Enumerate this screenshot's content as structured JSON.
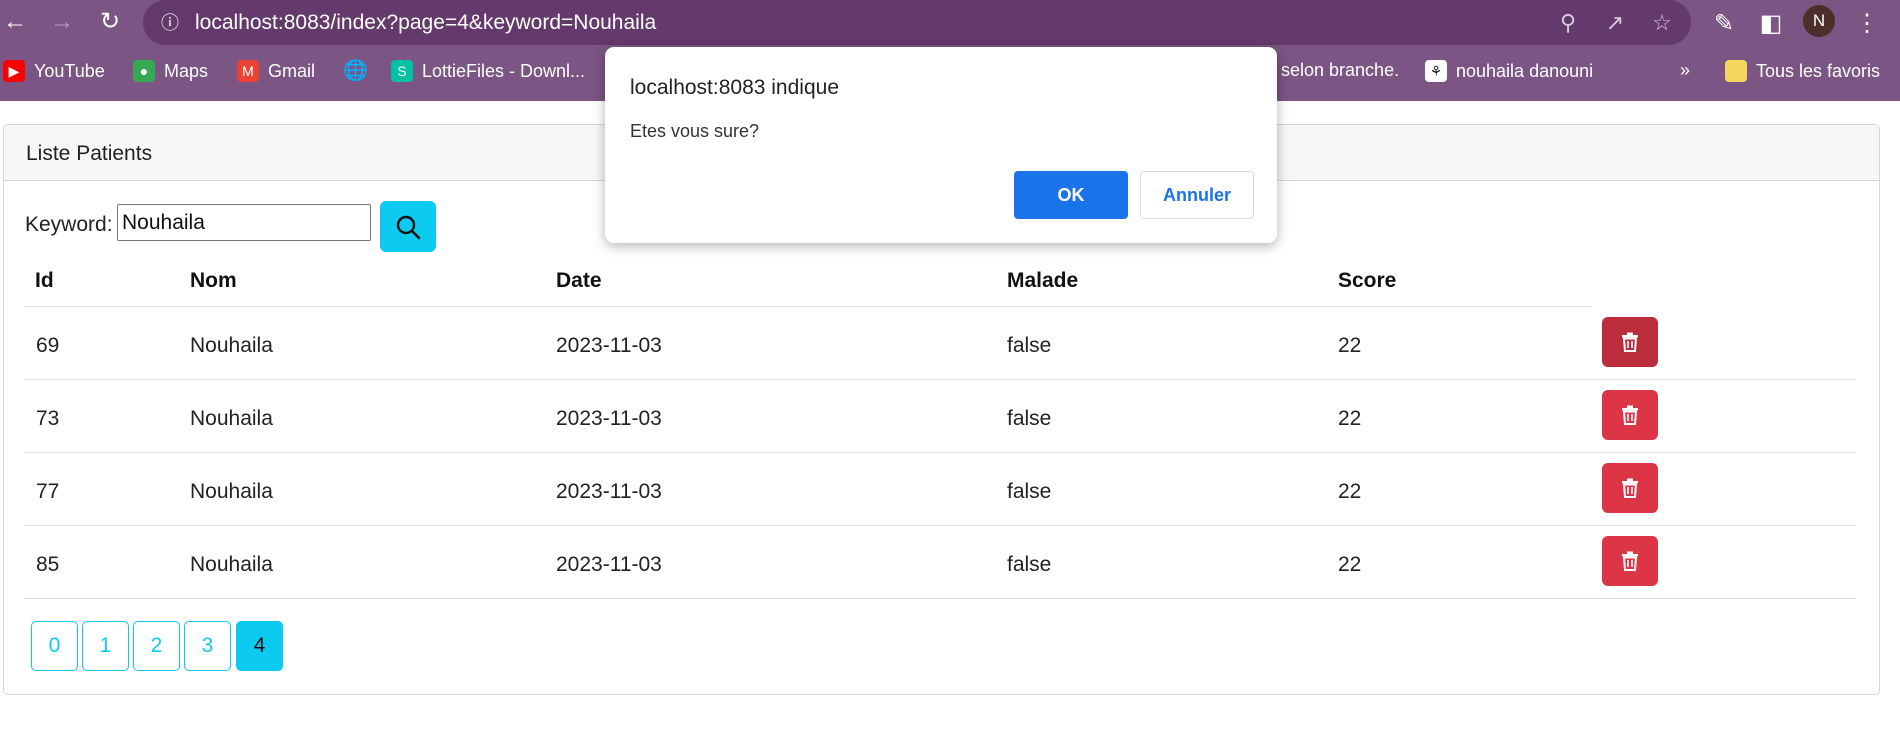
{
  "browser": {
    "url": "localhost:8083/index?page=4&keyword=Nouhaila",
    "profile_initial": "N",
    "colors": {
      "frame": "#7b5583",
      "omnibox": "#64396b"
    }
  },
  "bookmarks": {
    "items": [
      {
        "label": "YouTube",
        "icon": "youtube-icon"
      },
      {
        "label": "Maps",
        "icon": "maps-icon"
      },
      {
        "label": "Gmail",
        "icon": "gmail-icon"
      },
      {
        "label": "",
        "icon": "globe-icon"
      },
      {
        "label": "LottieFiles - Downl...",
        "icon": "lottiefiles-icon"
      },
      {
        "label": "r selon branche.",
        "icon": ""
      },
      {
        "label": "nouhaila danouni",
        "icon": "fleur-de-lis-icon"
      }
    ],
    "overflow": "»",
    "all_bookmarks": "Tous les favoris"
  },
  "page": {
    "card_title": "Liste Patients",
    "keyword_label": "Keyword:",
    "keyword_value": "Nouhaila",
    "table": {
      "headers": [
        "Id",
        "Nom",
        "Date",
        "Malade",
        "Score"
      ],
      "rows": [
        {
          "id": "69",
          "nom": "Nouhaila",
          "date": "2023-11-03",
          "malade": "false",
          "score": "22"
        },
        {
          "id": "73",
          "nom": "Nouhaila",
          "date": "2023-11-03",
          "malade": "false",
          "score": "22"
        },
        {
          "id": "77",
          "nom": "Nouhaila",
          "date": "2023-11-03",
          "malade": "false",
          "score": "22"
        },
        {
          "id": "85",
          "nom": "Nouhaila",
          "date": "2023-11-03",
          "malade": "false",
          "score": "22"
        }
      ]
    },
    "pagination": {
      "pages": [
        "0",
        "1",
        "2",
        "3",
        "4"
      ],
      "active": "4"
    },
    "colors": {
      "info": "#0dcaf0",
      "danger": "#dc3545",
      "danger_hover": "#bb2d3b"
    }
  },
  "dialog": {
    "title": "localhost:8083 indique",
    "message": "Etes vous sure?",
    "ok_label": "OK",
    "cancel_label": "Annuler",
    "colors": {
      "primary": "#1a73e8"
    }
  }
}
